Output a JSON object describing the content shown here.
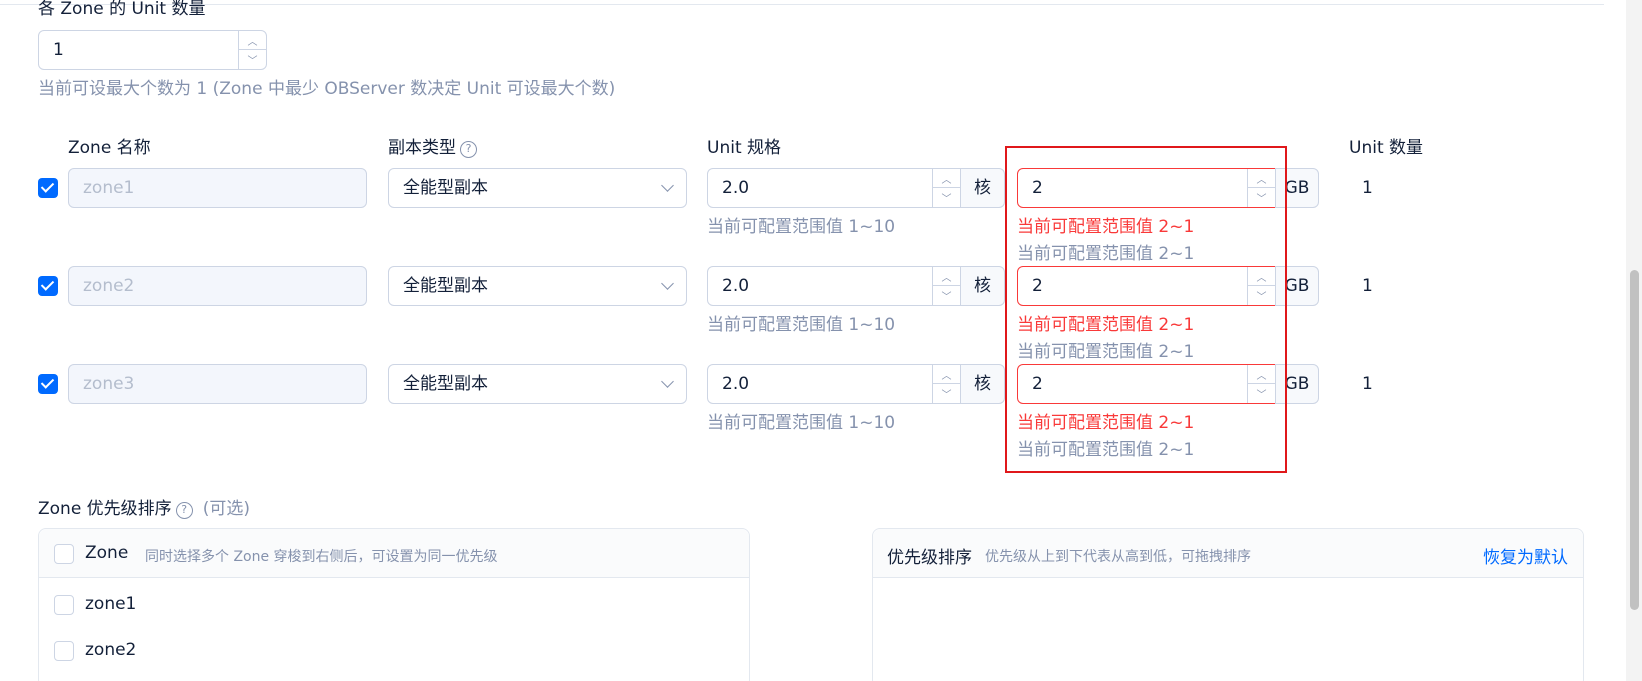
{
  "section": {
    "title": "各 Zone 的 Unit 数量",
    "unit_count_value": "1",
    "help": "当前可设最大个数为 1 (Zone 中最少 OBServer 数决定 Unit 可设最大个数)"
  },
  "table": {
    "headers": {
      "zone_name": "Zone 名称",
      "replica_type": "副本类型",
      "unit_spec": "Unit 规格",
      "unit_count": "Unit 数量"
    },
    "core_unit": "核",
    "mem_unit": "GB",
    "cpu_range_help": "当前可配置范围值 1~10",
    "mem_range_error": "当前可配置范围值 2~1",
    "mem_range_help": "当前可配置范围值 2~1",
    "rows": [
      {
        "zone": "zone1",
        "replica": "全能型副本",
        "cpu": "2.0",
        "memory": "2",
        "count": "1"
      },
      {
        "zone": "zone2",
        "replica": "全能型副本",
        "cpu": "2.0",
        "memory": "2",
        "count": "1"
      },
      {
        "zone": "zone3",
        "replica": "全能型副本",
        "cpu": "2.0",
        "memory": "2",
        "count": "1"
      }
    ]
  },
  "priority": {
    "title": "Zone 优先级排序",
    "optional": "(可选)",
    "left_panel": {
      "title": "Zone",
      "hint": "同时选择多个 Zone 穿梭到右侧后，可设置为同一优先级",
      "items": [
        "zone1",
        "zone2"
      ]
    },
    "right_panel": {
      "title": "优先级排序",
      "hint": "优先级从上到下代表从高到低，可拖拽排序",
      "reset": "恢复为默认"
    }
  },
  "colors": {
    "primary": "#006aff",
    "error": "#f93939",
    "highlight_box": "#e0181b"
  }
}
